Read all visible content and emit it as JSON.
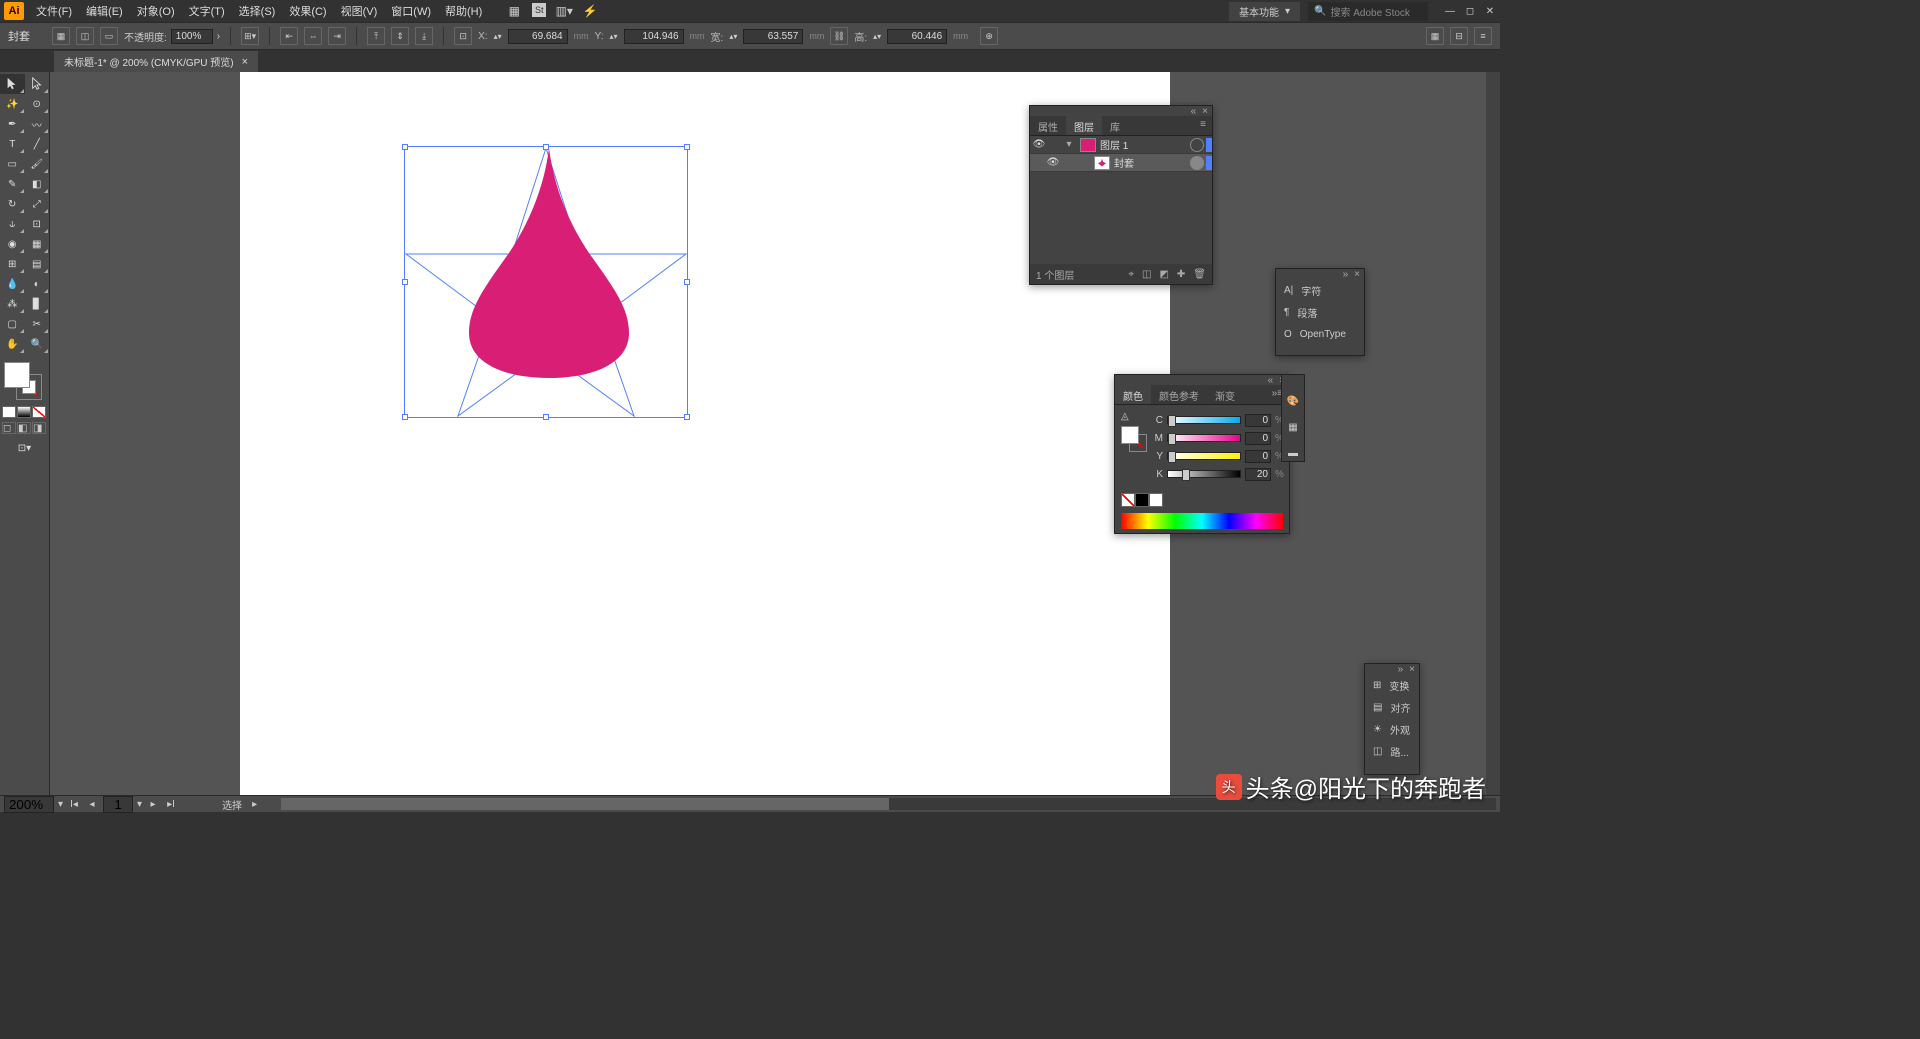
{
  "menubar": {
    "logo": "Ai",
    "items": [
      "文件(F)",
      "编辑(E)",
      "对象(O)",
      "文字(T)",
      "选择(S)",
      "效果(C)",
      "视图(V)",
      "窗口(W)",
      "帮助(H)"
    ],
    "workspace": "基本功能",
    "search_placeholder": "搜索 Adobe Stock"
  },
  "ctrlbar": {
    "selection_label": "封套",
    "opacity_label": "不透明度:",
    "opacity_value": "100%",
    "x_label": "X:",
    "x_value": "69.684",
    "x_unit": "mm",
    "y_label": "Y:",
    "y_value": "104.946",
    "y_unit": "mm",
    "w_label": "宽:",
    "w_value": "63.557",
    "w_unit": "mm",
    "h_label": "高:",
    "h_value": "60.446",
    "h_unit": "mm"
  },
  "doctab": {
    "title": "未标题-1* @ 200% (CMYK/GPU 预览)"
  },
  "layers": {
    "tabs": [
      "属性",
      "图层",
      "库"
    ],
    "rows": [
      {
        "name": "图层 1",
        "indent": 0
      },
      {
        "name": "封套",
        "indent": 1
      }
    ],
    "footer_count": "1 个图层"
  },
  "type_panel": {
    "rows": [
      "字符",
      "段落",
      "OpenType"
    ]
  },
  "color_panel": {
    "tabs": [
      "颜色",
      "颜色参考",
      "渐变"
    ],
    "sliders": [
      {
        "l": "C",
        "v": "0"
      },
      {
        "l": "M",
        "v": "0"
      },
      {
        "l": "Y",
        "v": "0"
      },
      {
        "l": "K",
        "v": "20"
      }
    ]
  },
  "transform_panel": {
    "rows": [
      "变换",
      "对齐",
      "外观",
      "路..."
    ]
  },
  "statusbar": {
    "zoom": "200%",
    "page": "1",
    "status": "选择"
  },
  "watermark": "头条@阳光下的奔跑者"
}
